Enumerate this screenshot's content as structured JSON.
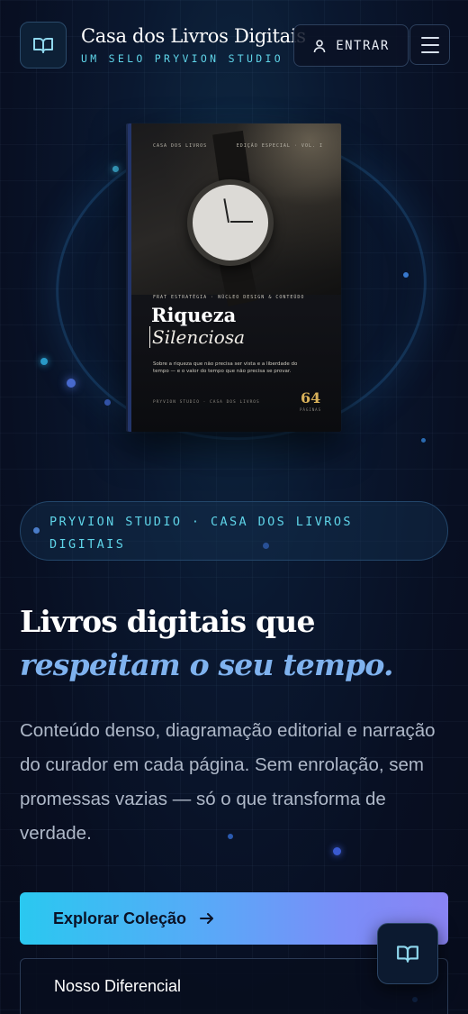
{
  "header": {
    "brand_title": "Casa dos Livros Digitais",
    "brand_subtitle": "UM SELO PRYVION STUDIO",
    "login_label": "ENTRAR",
    "logo_icon": "open-book-icon",
    "login_icon": "user-icon",
    "menu_icon": "hamburger-menu-icon"
  },
  "book": {
    "top_left": "CASA DOS LIVROS",
    "top_right": "EDIÇÃO ESPECIAL · VOL. I",
    "kicker": "FRAT ESTRATÉGIA · NÚCLEO DESIGN & CONTEÚDO",
    "title": "Riqueza",
    "subtitle": "Silenciosa",
    "blurb": "Sobre a riqueza que não precisa ser vista e a liberdade do tempo — e o valor do tempo que não precisa se provar.",
    "footer": "PRYVION STUDIO · CASA DOS LIVROS",
    "number": "64",
    "number_label": "PÁGINAS"
  },
  "badge": {
    "text": "PRYVION STUDIO · CASA DOS LIVROS DIGITAIS"
  },
  "hero": {
    "headline_line1": "Livros digitais que",
    "headline_accent": "respeitam o seu tempo.",
    "description": "Conteúdo denso, diagramação editorial e narração do curador em cada página. Sem enrolação, sem promessas vazias — só o que transforma de verdade."
  },
  "cta": {
    "primary_label": "Explorar Coleção",
    "primary_icon": "arrow-right-icon",
    "secondary_label": "Nosso Diferencial"
  },
  "fab": {
    "icon": "open-book-icon"
  },
  "colors": {
    "accent_cyan": "#5fd4e8",
    "accent_blue": "#7fb2ee",
    "gradient_start": "#2ac8f0",
    "gradient_end": "#8a84f4",
    "background": "#080f22"
  }
}
